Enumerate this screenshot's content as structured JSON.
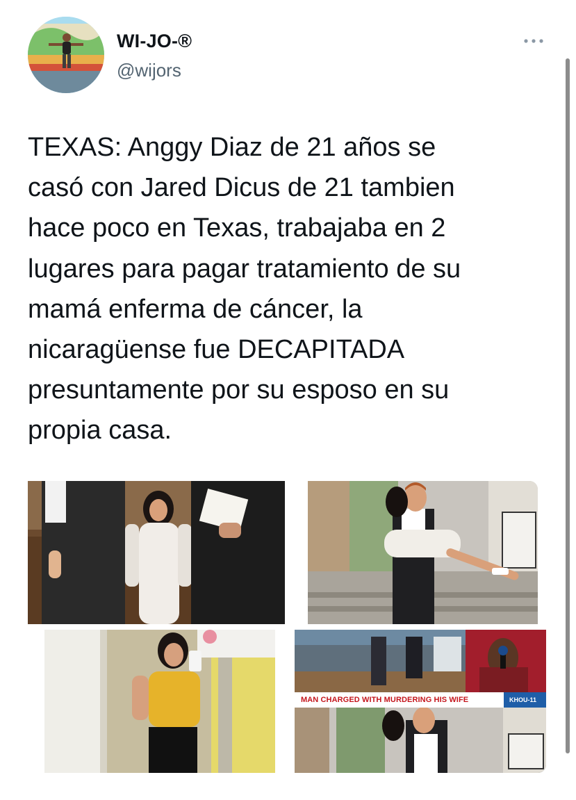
{
  "tweet": {
    "author": {
      "display_name": "WI-JO-®",
      "handle": "@wijors"
    },
    "more_icon": "more-dots-icon",
    "text": "TEXAS: Anggy Diaz de 21 años se\ncasó con Jared Dicus de 21 tambien\nhace poco en Texas, trabajaba en 2\nlugares para pagar tratamiento de su\nmamá enferma de cáncer, la\nnicaragüense fue DECAPITADA\npresuntamente por su esposo en su\npropia casa.",
    "media": {
      "news_headline": "MAN CHARGED WITH MURDERING HIS WIFE",
      "news_station": "KHOU-11"
    }
  },
  "colors": {
    "text": "#0f1419",
    "secondary": "#536471",
    "news_red": "#c4161c",
    "news_blue": "#1f5ea8"
  }
}
